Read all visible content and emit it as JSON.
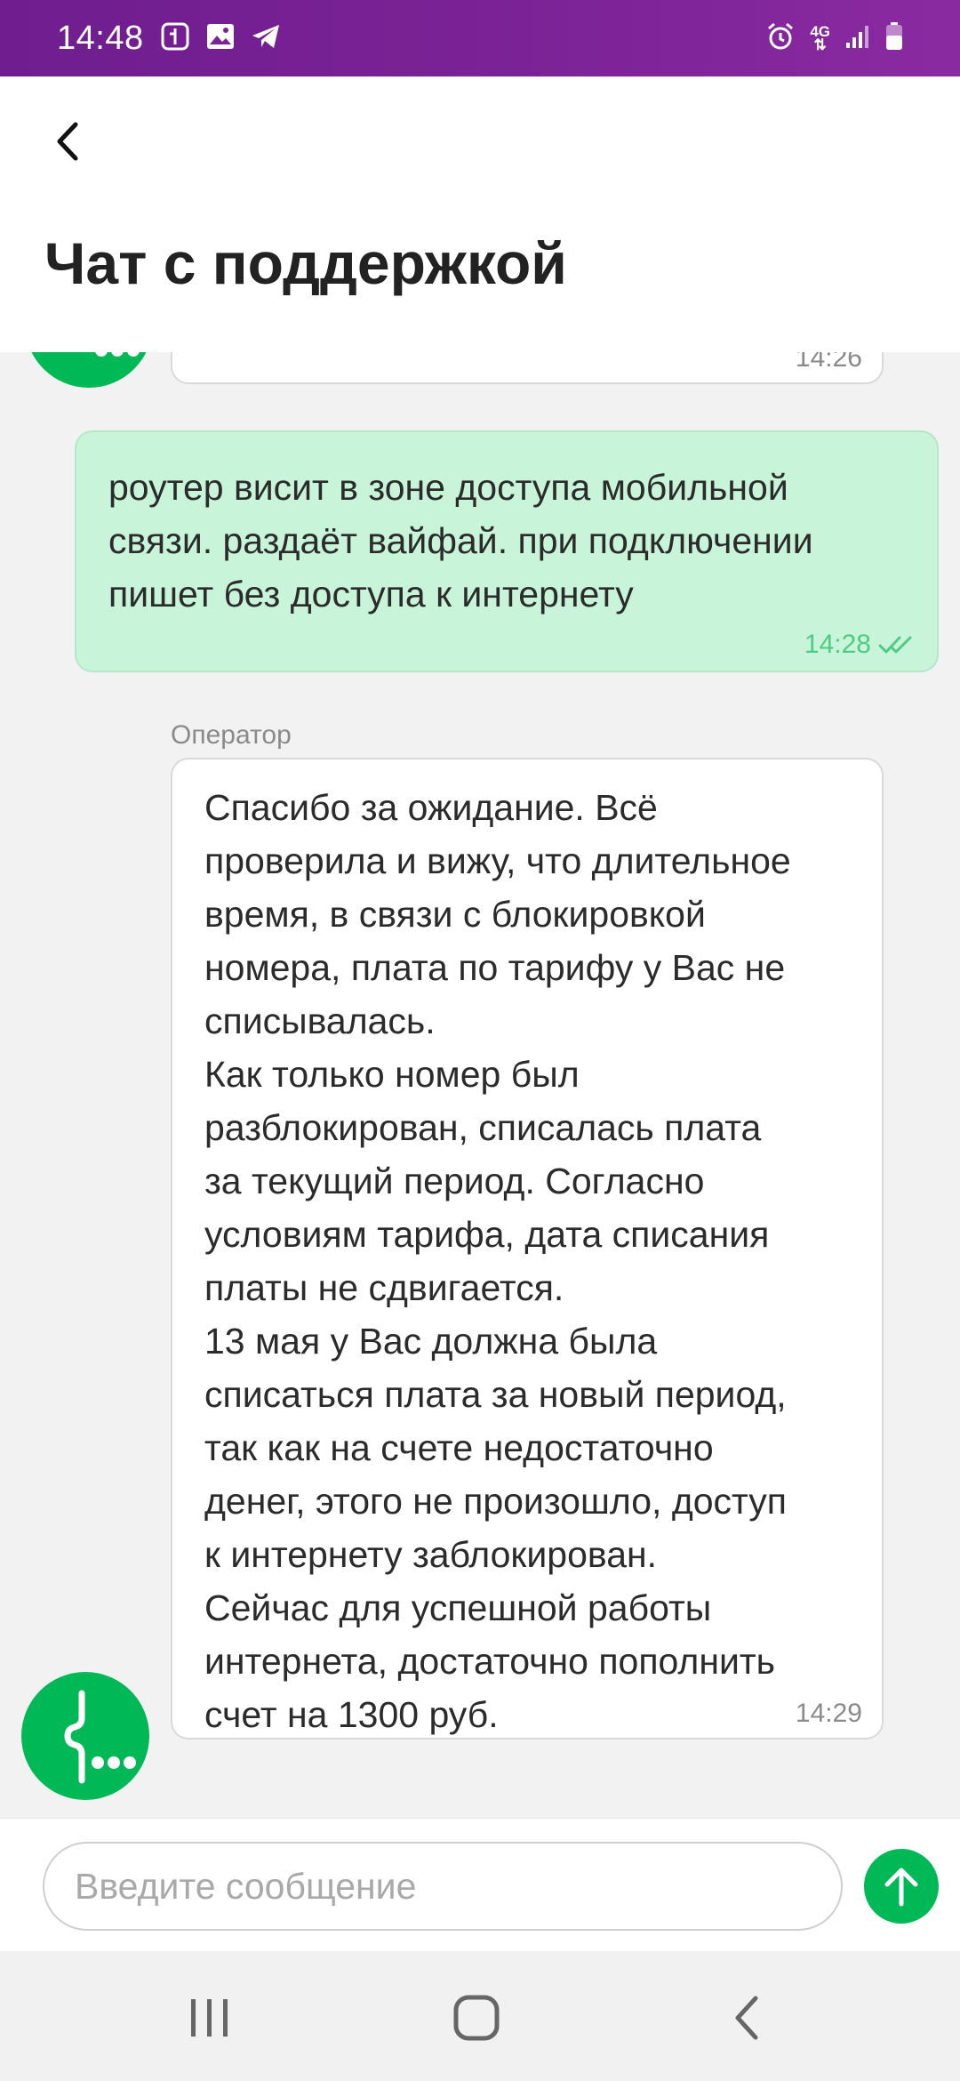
{
  "status_bar": {
    "time": "14:48",
    "network": "4G",
    "icons": [
      "wallet-icon",
      "image-icon",
      "telegram-icon",
      "alarm-icon",
      "signal-icon",
      "battery-icon"
    ]
  },
  "header": {
    "title": "Чат с поддержкой"
  },
  "messages": [
    {
      "direction": "in",
      "time": "14:26"
    },
    {
      "direction": "out",
      "lines": [
        "роутер висит в зоне доступа мобильной",
        "связи. раздаёт вайфай. при подключении",
        "пишет без доступа к интернету"
      ],
      "time": "14:28",
      "status": "read"
    },
    {
      "direction": "in",
      "sender": "Оператор",
      "lines": [
        "Спасибо за ожидание. Всё",
        "проверила и вижу, что длительное",
        "время, в связи с блокировкой",
        "номера, плата по тарифу у Вас не",
        "списывалась.",
        "Как только номер был",
        "разблокирован, списалась плата",
        "за текущий период. Согласно",
        "условиям тарифа, дата списания",
        "платы не сдвигается.",
        "13 мая у Вас должна была",
        "списаться плата за новый период,",
        "так как на счете недостаточно",
        "денег, этого не произошло, доступ",
        "к интернету заблокирован.",
        "Сейчас для успешной работы",
        "интернета, достаточно пополнить",
        "счет на 1300 руб."
      ],
      "time": "14:29"
    }
  ],
  "input": {
    "placeholder": "Введите сообщение"
  },
  "colors": {
    "brand_green": "#00b956",
    "status_bar_purple": "#7b2396",
    "outgoing_bubble": "#c8f4da"
  }
}
